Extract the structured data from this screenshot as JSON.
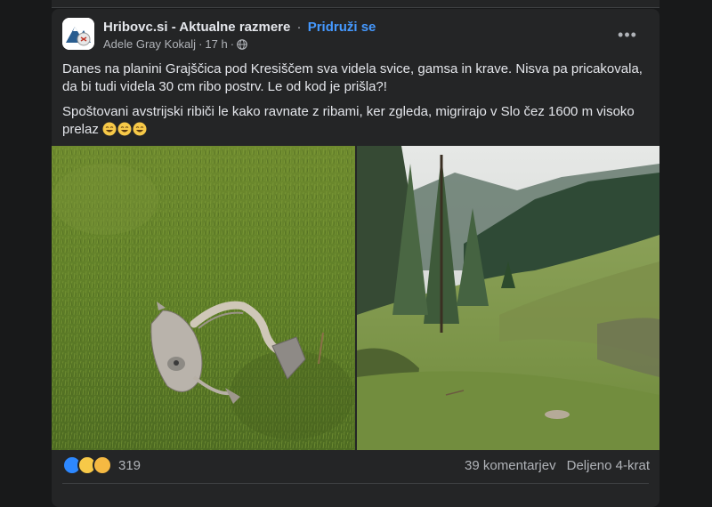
{
  "post": {
    "group_name": "Hribovc.si - Aktualne razmere",
    "separator": "·",
    "join_label": "Pridruži se",
    "author": "Adele Gray Kokalj",
    "time": "17 h",
    "more_label": "•••",
    "text_p1": "Danes na planini Grajščica pod Kresiščem sva videla svice, gamsa in krave. Nisva pa pricakovala, da bi tudi videla 30 cm ribo postrv. Le od kod je prišla?!",
    "text_p2": "Spoštovani avstrijski ribiči le kako ravnate z ribami, ker zgleda, migrirajo v Slo čez 1600 m visoko prelaz",
    "reaction_count": "319",
    "comments": "39 komentarjev",
    "shares": "Deljeno 4-krat"
  },
  "colors": {
    "accent": "#4599ff",
    "card": "#242526",
    "background": "#18191a"
  },
  "icons": [
    "globe-icon",
    "more-icon",
    "like-icon",
    "haha-icon",
    "wow-icon",
    "laughing-emoji-icon"
  ]
}
